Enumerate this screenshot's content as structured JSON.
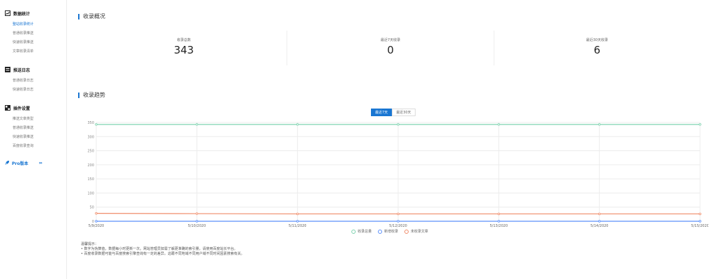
{
  "sidebar": {
    "groups": [
      {
        "title": "数据统计",
        "icon": "chart-icon",
        "items": [
          "整站收录统计",
          "普通收录推送",
          "快速收录推送",
          "文章收录清单"
        ],
        "active": 0
      },
      {
        "title": "推送日志",
        "icon": "log-icon",
        "items": [
          "普通收录日志",
          "快速收录日志"
        ],
        "active": -1
      },
      {
        "title": "插件设置",
        "icon": "settings-icon",
        "items": [
          "推送文章类型",
          "普通收录推送",
          "快速收录推送",
          "百度收录查询"
        ],
        "active": -1
      }
    ],
    "pro": {
      "label": "Pro版本",
      "arrows": "›››",
      "icon": "rocket-icon"
    }
  },
  "overview": {
    "title": "收录概况",
    "stats": [
      {
        "label": "收录总数",
        "value": "343"
      },
      {
        "label": "最近7天收录",
        "value": "0"
      },
      {
        "label": "最近30天收录",
        "value": "6"
      }
    ]
  },
  "trend": {
    "title": "收录趋势",
    "tabs": [
      "最近7天",
      "最近30天"
    ],
    "active_tab": 0
  },
  "chart_data": {
    "type": "line",
    "x": [
      "5/9/2020",
      "5/10/2020",
      "5/11/2020",
      "5/12/2020",
      "5/13/2020",
      "5/14/2020",
      "5/15/2020"
    ],
    "series": [
      {
        "name": "收录总量",
        "values": [
          343,
          343,
          343,
          343,
          343,
          343,
          343
        ],
        "color": "#7fd3b0"
      },
      {
        "name": "新增收录",
        "values": [
          0,
          0,
          0,
          0,
          0,
          0,
          0
        ],
        "color": "#5b8ff9"
      },
      {
        "name": "未收录文章",
        "values": [
          28,
          27,
          26,
          26,
          26,
          26,
          26
        ],
        "color": "#f08c6a"
      }
    ],
    "ylim": [
      0,
      350
    ],
    "yticks": [
      0,
      50,
      100,
      150,
      200,
      250,
      300,
      350
    ],
    "grid": true,
    "legend": "bottom"
  },
  "tips": {
    "title": "温馨提示：",
    "lines": [
      "• 数字为伪算值，数据每小时更新一次，网站管理员如需了解更准确的索引量，请使用百度站长平台。",
      "• 百度收录数据可能与百度搜索引擎查询有一定的差异，这跟不同地域不同用户域不同时间因素搜索有关。"
    ]
  }
}
